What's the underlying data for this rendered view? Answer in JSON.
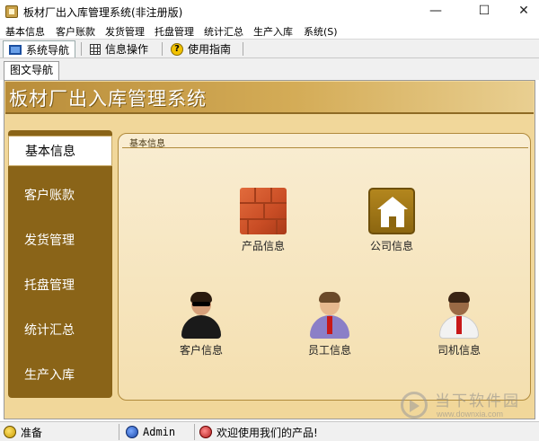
{
  "window": {
    "title": "板材厂出入库管理系统(非注册版)",
    "controls": {
      "minimize": "—",
      "maximize": "☐",
      "close": "✕"
    }
  },
  "menu": [
    {
      "label": "基本信息"
    },
    {
      "label": "客户账款"
    },
    {
      "label": "发货管理"
    },
    {
      "label": "托盘管理"
    },
    {
      "label": "统计汇总"
    },
    {
      "label": "生产入库"
    },
    {
      "label": "系统(S)"
    }
  ],
  "toolbar": {
    "tabs": [
      {
        "label": "系统导航",
        "icon": "monitor-icon"
      },
      {
        "label": "信息操作",
        "icon": "grid-icon"
      },
      {
        "label": "使用指南",
        "icon": "help-icon",
        "icon_glyph": "?"
      }
    ]
  },
  "subtab": {
    "label": "图文导航"
  },
  "banner": {
    "title": "板材厂出入库管理系统"
  },
  "sidenav": {
    "items": [
      {
        "label": "基本信息"
      },
      {
        "label": "客户账款"
      },
      {
        "label": "发货管理"
      },
      {
        "label": "托盘管理"
      },
      {
        "label": "统计汇总"
      },
      {
        "label": "生产入库"
      }
    ]
  },
  "content": {
    "title": "基本信息",
    "tiles": [
      {
        "label": "产品信息",
        "icon": "bricks-icon"
      },
      {
        "label": "公司信息",
        "icon": "house-icon"
      },
      {
        "label": "客户信息",
        "icon": "customer-icon"
      },
      {
        "label": "员工信息",
        "icon": "employee-icon"
      },
      {
        "label": "司机信息",
        "icon": "driver-icon"
      }
    ]
  },
  "status": {
    "ready": "准备",
    "user": "Admin",
    "welcome": "欢迎使用我们的产品!"
  },
  "watermark": {
    "text": "当下软件园",
    "url": "www.downxia.com"
  },
  "colors": {
    "banner": "#c9a04a",
    "sidenav": "#8a6418",
    "content_bg": "#f7e6bd"
  }
}
